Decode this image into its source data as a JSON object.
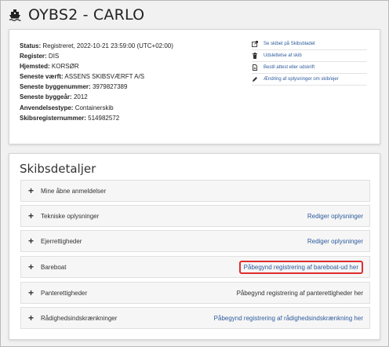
{
  "header": {
    "title": "OYBS2 - CARLO",
    "icon": "ship-icon"
  },
  "info": {
    "rows": [
      {
        "label": "Status:",
        "value": "Registreret, 2022-10-21 23:59:00 (UTC+02:00)"
      },
      {
        "label": "Register:",
        "value": "DIS"
      },
      {
        "label": "Hjemsted:",
        "value": "KORSØR"
      },
      {
        "label": "Seneste værft:",
        "value": "ASSENS SKIBSVÆRFT A/S"
      },
      {
        "label": "Seneste byggenummer:",
        "value": "3979827389"
      },
      {
        "label": "Seneste byggeår:",
        "value": "2012"
      },
      {
        "label": "Anvendelsestype:",
        "value": "Containerskib"
      },
      {
        "label": "Skibsregisternummer:",
        "value": "514982572"
      }
    ],
    "actions": [
      {
        "label": "Se skibet på Skibsbladet",
        "icon": "external-link-icon"
      },
      {
        "label": "Udslettelse af skib",
        "icon": "trash-icon"
      },
      {
        "label": "Bestil attest eller udskrift",
        "icon": "document-icon"
      },
      {
        "label": "Ændring af oplysninger om skib/ejer",
        "icon": "pencil-icon"
      }
    ]
  },
  "details": {
    "title": "Skibsdetaljer",
    "sections": [
      {
        "label": "Mine åbne anmeldelser",
        "action": ""
      },
      {
        "label": "Tekniske oplysninger",
        "action": "Rediger oplysninger"
      },
      {
        "label": "Ejerrettigheder",
        "action": "Rediger oplysninger"
      },
      {
        "label": "Bareboat",
        "action": "Påbegynd registrering af bareboat-ud her"
      },
      {
        "label": "Panterettigheder",
        "action": "Påbegynd registrering af panterettigheder her"
      },
      {
        "label": "Rådighedsindskrænkninger",
        "action": "Påbegynd registrering af rådighedsindskrænkning her"
      }
    ]
  },
  "colors": {
    "link": "#2d5b9c",
    "highlight": "#e02e2e"
  }
}
